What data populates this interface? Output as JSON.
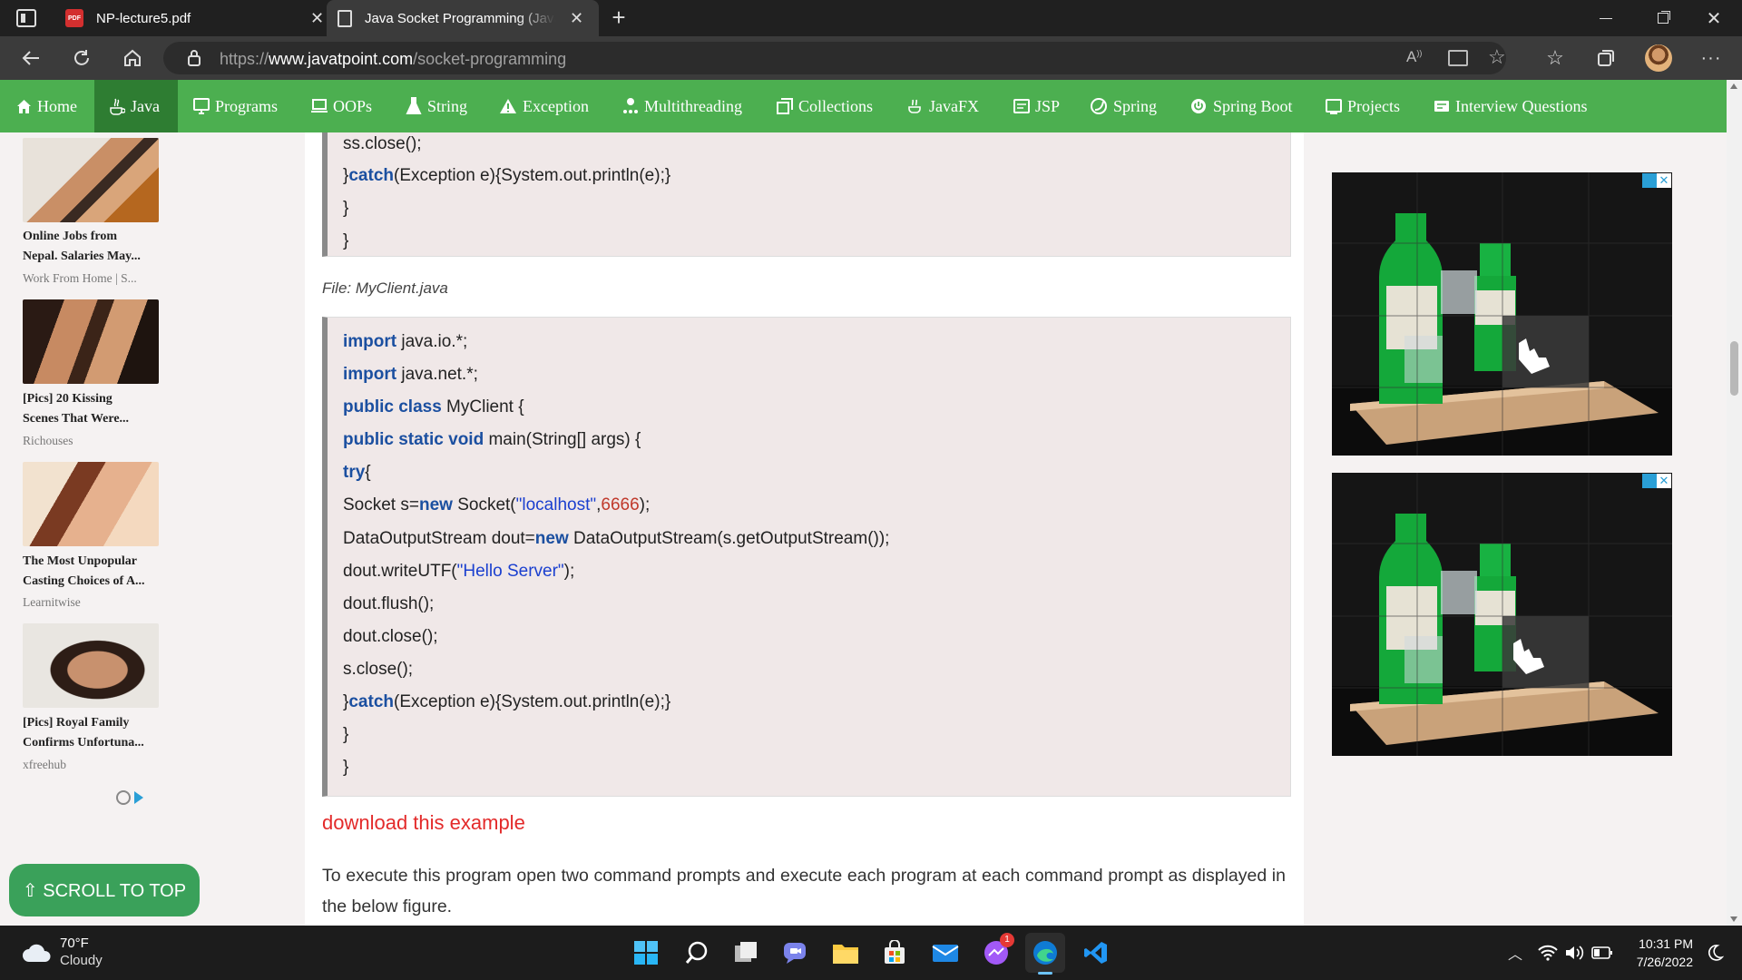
{
  "browser": {
    "tabs": [
      {
        "title": "NP-lecture5.pdf",
        "icon": "pdf-icon"
      },
      {
        "title": "Java Socket Programming (Java",
        "icon": "page-icon"
      }
    ],
    "url_prefix": "https://",
    "url_host": "www.javatpoint.com",
    "url_path": "/socket-programming"
  },
  "site_nav": [
    "Home",
    "Java",
    "Programs",
    "OOPs",
    "String",
    "Exception",
    "Multithreading",
    "Collections",
    "JavaFX",
    "JSP",
    "Spring",
    "Spring Boot",
    "Projects",
    "Interview Questions"
  ],
  "sidebar_ads": [
    {
      "title_1": "Online Jobs from",
      "title_2": "Nepal. Salaries May...",
      "source": "Work From Home | S..."
    },
    {
      "title_1": "[Pics] 20 Kissing",
      "title_2": "Scenes That Were...",
      "source": "Richouses"
    },
    {
      "title_1": "The Most Unpopular",
      "title_2": "Casting Choices of A...",
      "source": "Learnitwise"
    },
    {
      "title_1": "[Pics] Royal Family",
      "title_2": "Confirms Unfortuna...",
      "source": "xfreehub"
    }
  ],
  "scroll_top": "⇧ SCROLL TO TOP",
  "code_top": {
    "l1": "ss.close();",
    "l2a": "}",
    "l2b": "catch",
    "l2c": "(Exception e){System.out.println(e);}",
    "l3": "}",
    "l4": "}"
  },
  "file_label": "File: MyClient.java",
  "code_main": {
    "l1a": "import",
    "l1b": " java.io.*;",
    "l2a": "import",
    "l2b": " java.net.*;",
    "l3a": "public class",
    "l3b": " MyClient {",
    "l4a": "public static void",
    "l4b": " main(String[] args) {",
    "l5a": "try",
    "l5b": "{",
    "l6a": "Socket s=",
    "l6b": "new",
    "l6c": " Socket(",
    "l6d": "\"localhost\"",
    "l6e": ",",
    "l6f": "6666",
    "l6g": ");",
    "l7a": "DataOutputStream dout=",
    "l7b": "new",
    "l7c": " DataOutputStream(s.getOutputStream());",
    "l8a": "dout.writeUTF(",
    "l8b": "\"Hello Server\"",
    "l8c": ");",
    "l9": "dout.flush();",
    "l10": "dout.close();",
    "l11": "s.close();",
    "l12a": "}",
    "l12b": "catch",
    "l12c": "(Exception e){System.out.println(e);}",
    "l13": "}",
    "l14": "}"
  },
  "download_link": "download this example",
  "paragraph": "To execute this program open two command prompts and execute each program at each command prompt as displayed in the below figure.",
  "taskbar": {
    "temp": "70°F",
    "condition": "Cloudy",
    "time": "10:31 PM",
    "date": "7/26/2022",
    "messenger_badge": "1"
  },
  "colors": {
    "nav_green": "#4caf50",
    "nav_active": "#2e7d32",
    "keyword": "#1b4fa0",
    "link_red": "#e32a2a"
  }
}
